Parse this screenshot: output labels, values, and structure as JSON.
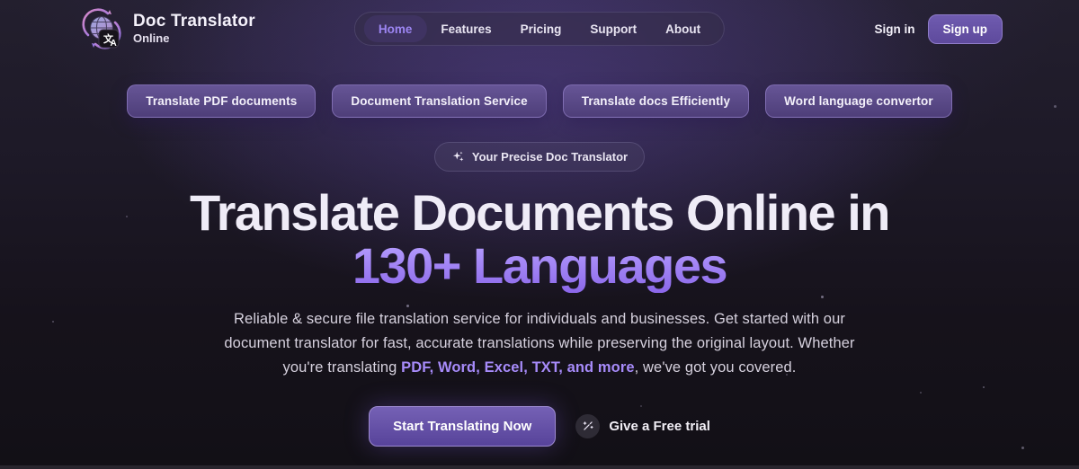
{
  "header": {
    "brand": {
      "title": "Doc Translator",
      "subtitle": "Online",
      "logo_icon": "globe-translate-icon"
    },
    "nav": {
      "items": [
        {
          "label": "Home",
          "active": true
        },
        {
          "label": "Features",
          "active": false
        },
        {
          "label": "Pricing",
          "active": false
        },
        {
          "label": "Support",
          "active": false
        },
        {
          "label": "About",
          "active": false
        }
      ]
    },
    "signin_label": "Sign in",
    "signup_label": "Sign up"
  },
  "keyword_pills": [
    "Translate PDF documents",
    "Document Translation Service",
    "Translate docs Efficiently",
    "Word language convertor"
  ],
  "hero": {
    "badge": {
      "icon": "sparkles-icon",
      "label": "Your Precise Doc Translator"
    },
    "title_line1": "Translate Documents Online in",
    "title_line2": "130+ Languages",
    "description_part1": "Reliable & secure file translation service for individuals and businesses. Get started with our document translator for fast, accurate translations while preserving the original layout. Whether you're translating ",
    "description_highlight": "PDF, Word, Excel, TXT, and more",
    "description_part2": ", we've got you covered.",
    "cta_primary_label": "Start Translating Now",
    "cta_secondary": {
      "icon": "wand-icon",
      "label": "Give a Free trial"
    }
  },
  "colors": {
    "accent_purple": "#8b67ea",
    "accent_light_purple": "#a78bfa",
    "nav_active": "#9c85f2",
    "pill_gradient_top": "#665596",
    "pill_gradient_bottom": "#4e3e79",
    "signup_button": "#64519f",
    "background_top": "#231f2e",
    "background_bottom": "#121016"
  }
}
